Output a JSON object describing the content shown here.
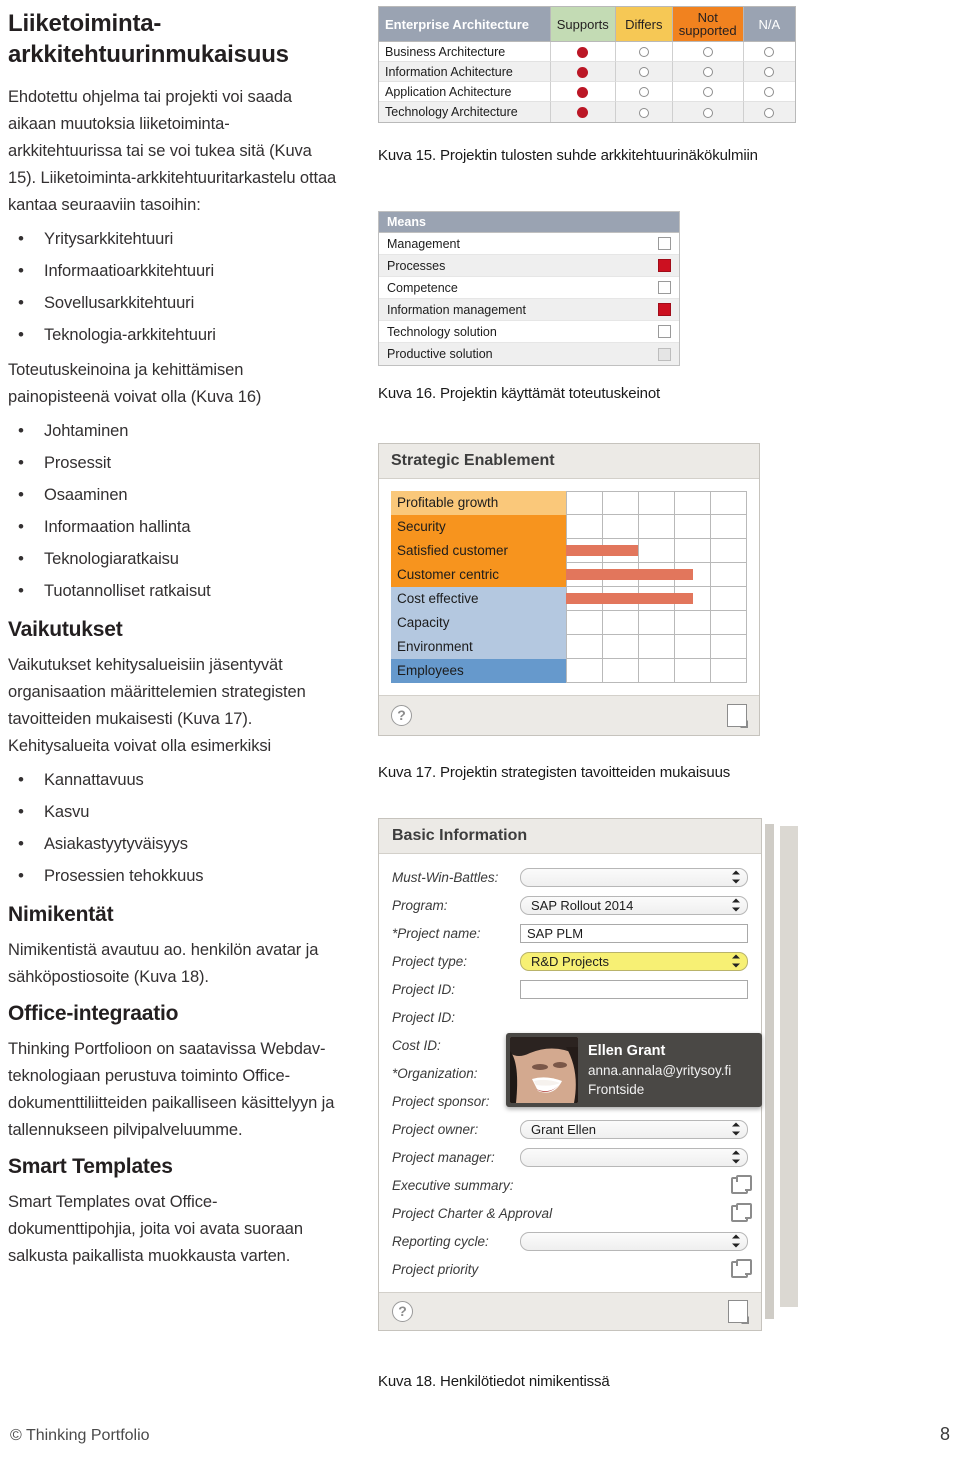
{
  "left": {
    "heading1": "Liiketoiminta-arkkitehtuurinmukaisuus",
    "para1": "Ehdotettu ohjelma tai projekti voi saada aikaan muutoksia liiketoiminta-arkkitehtuurissa tai se voi tukea sitä (Kuva 15). Liiketoiminta-arkkitehtuuritarkastelu ottaa kantaa seuraaviin tasoihin:",
    "list1": [
      "Yritysarkkitehtuuri",
      "Informaatioarkkitehtuuri",
      "Sovellusarkkitehtuuri",
      "Teknologia-arkkitehtuuri"
    ],
    "para2": "Toteutuskeinoina ja kehittämisen painopisteenä voivat olla (Kuva 16)",
    "list2": [
      "Johtaminen",
      "Prosessit",
      "Osaaminen",
      "Informaation hallinta",
      "Teknologiaratkaisu",
      "Tuotannolliset ratkaisut"
    ],
    "heading2": "Vaikutukset",
    "para3": "Vaikutukset kehitysalueisiin jäsentyvät organisaation määrittelemien strategisten tavoitteiden mukaisesti (Kuva 17). Kehitysalueita voivat olla esimerkiksi",
    "list3": [
      "Kannattavuus",
      "Kasvu",
      "Asiakastyytyväisyys",
      "Prosessien tehokkuus"
    ],
    "heading3": "Nimikentät",
    "para4": "Nimikentistä avautuu ao. henkilön avatar ja sähköpostiosoite (Kuva 18).",
    "heading4": "Office-integraatio",
    "para5": "Thinking Portfolioon on saatavissa Webdav-teknologiaan perustuva toiminto Office-dokumenttiliitteiden paikalliseen käsittelyyn ja tallennukseen pilvipalveluumme.",
    "heading5": "Smart Templates",
    "para6": "Smart Templates ovat Office-dokumenttipohjia, joita voi avata suoraan salkusta paikallista muokkausta varten."
  },
  "fig15": {
    "caption_number": "Kuva 15.",
    "caption_text": "Projektin tulosten suhde arkkitehtuurinäkökulmiin",
    "columns": [
      "Enterprise Architecture",
      "Supports",
      "Differs",
      "Not supported",
      "N/A"
    ],
    "rows": [
      {
        "label": "Business Architecture",
        "values": [
          "filled",
          "empty",
          "empty",
          "empty"
        ]
      },
      {
        "label": "Information Achitecture",
        "values": [
          "filled",
          "empty",
          "empty",
          "empty"
        ]
      },
      {
        "label": "Application Achitecture",
        "values": [
          "filled",
          "empty",
          "empty",
          "empty"
        ]
      },
      {
        "label": "Technology Architecture",
        "values": [
          "filled",
          "empty",
          "empty",
          "empty"
        ]
      }
    ],
    "colors": {
      "header_ea": "#9aa3b2",
      "header_supports": "#c3dbb4",
      "header_differs": "#f6c855",
      "header_not_supported": "#f1821f",
      "header_na": "#9aa3b2",
      "dot_filled": "#bb1726"
    }
  },
  "fig16": {
    "caption_number": "Kuva 16.",
    "caption_text": "Projektin käyttämät toteutuskeinot",
    "title": "Means",
    "rows": [
      {
        "label": "Management",
        "state": "off"
      },
      {
        "label": "Processes",
        "state": "on"
      },
      {
        "label": "Competence",
        "state": "off"
      },
      {
        "label": "Information management",
        "state": "on"
      },
      {
        "label": "Technology solution",
        "state": "off"
      },
      {
        "label": "Productive solution",
        "state": "dim"
      }
    ],
    "colors": {
      "header": "#9aa3b2",
      "checked": "#cc1020"
    }
  },
  "fig17": {
    "caption_number": "Kuva 17.",
    "caption_text": "Projektin strategisten tavoitteiden mukaisuus",
    "title": "Strategic Enablement",
    "help_icon": "question-mark-icon",
    "doc_icon": "document-icon",
    "chart_columns": 5,
    "rows": [
      {
        "label": "Profitable growth",
        "color": "#fac87a",
        "bar": 0
      },
      {
        "label": "Security",
        "color": "#f7941e",
        "bar": 0
      },
      {
        "label": "Satisfied customer",
        "color": "#f7941e",
        "bar": 2
      },
      {
        "label": "Customer centric",
        "color": "#f7941e",
        "bar": 3.5
      },
      {
        "label": "Cost effective",
        "color": "#b4c8e0",
        "bar": 3.5
      },
      {
        "label": "Capacity",
        "color": "#b4c8e0",
        "bar": 0
      },
      {
        "label": "Environment",
        "color": "#b4c8e0",
        "bar": 0
      },
      {
        "label": "Employees",
        "color": "#6699cc",
        "bar": 0
      }
    ],
    "colors": {
      "bar": "#e2765c",
      "panel_header_bg": "#eceae6"
    }
  },
  "fig18": {
    "caption_number": "Kuva 18.",
    "caption_text": "Henkilötiedot nimikentissä",
    "title": "Basic Information",
    "help_icon": "question-mark-icon",
    "doc_icon": "document-icon",
    "fields": [
      {
        "label": "Must-Win-Battles:",
        "control": "select",
        "value": ""
      },
      {
        "label": "Program:",
        "control": "select",
        "value": "SAP Rollout 2014"
      },
      {
        "label": "*Project name:",
        "control": "text",
        "value": "SAP PLM"
      },
      {
        "label": "Project type:",
        "control": "select-highlight",
        "value": "R&D Projects"
      },
      {
        "label": "Project ID:",
        "control": "text",
        "value": ""
      },
      {
        "label": "Project ID:",
        "control": "none",
        "value": ""
      },
      {
        "label": "Cost ID:",
        "control": "none",
        "value": ""
      },
      {
        "label": "*Organization:",
        "control": "none",
        "value": ""
      },
      {
        "label": "Project sponsor:",
        "control": "none",
        "value": ""
      },
      {
        "label": "Project owner:",
        "control": "select",
        "value": "Grant Ellen"
      },
      {
        "label": "Project manager:",
        "control": "select",
        "value": ""
      },
      {
        "label": "Executive summary:",
        "control": "extlink",
        "value": ""
      },
      {
        "label": "Project Charter & Approval",
        "control": "extlink",
        "value": ""
      },
      {
        "label": "Reporting cycle:",
        "control": "select",
        "value": ""
      },
      {
        "label": "Project priority",
        "control": "extlink",
        "value": ""
      }
    ],
    "tooltip": {
      "name": "Ellen Grant",
      "email": "anna.annala@yritysoy.fi",
      "role": "Frontside",
      "avatar": "person-avatar"
    },
    "colors": {
      "highlight": "#f7f074",
      "tooltip_bg": "#4a4845"
    }
  },
  "footer": {
    "copyright": "© Thinking Portfolio",
    "page_number": "8"
  }
}
